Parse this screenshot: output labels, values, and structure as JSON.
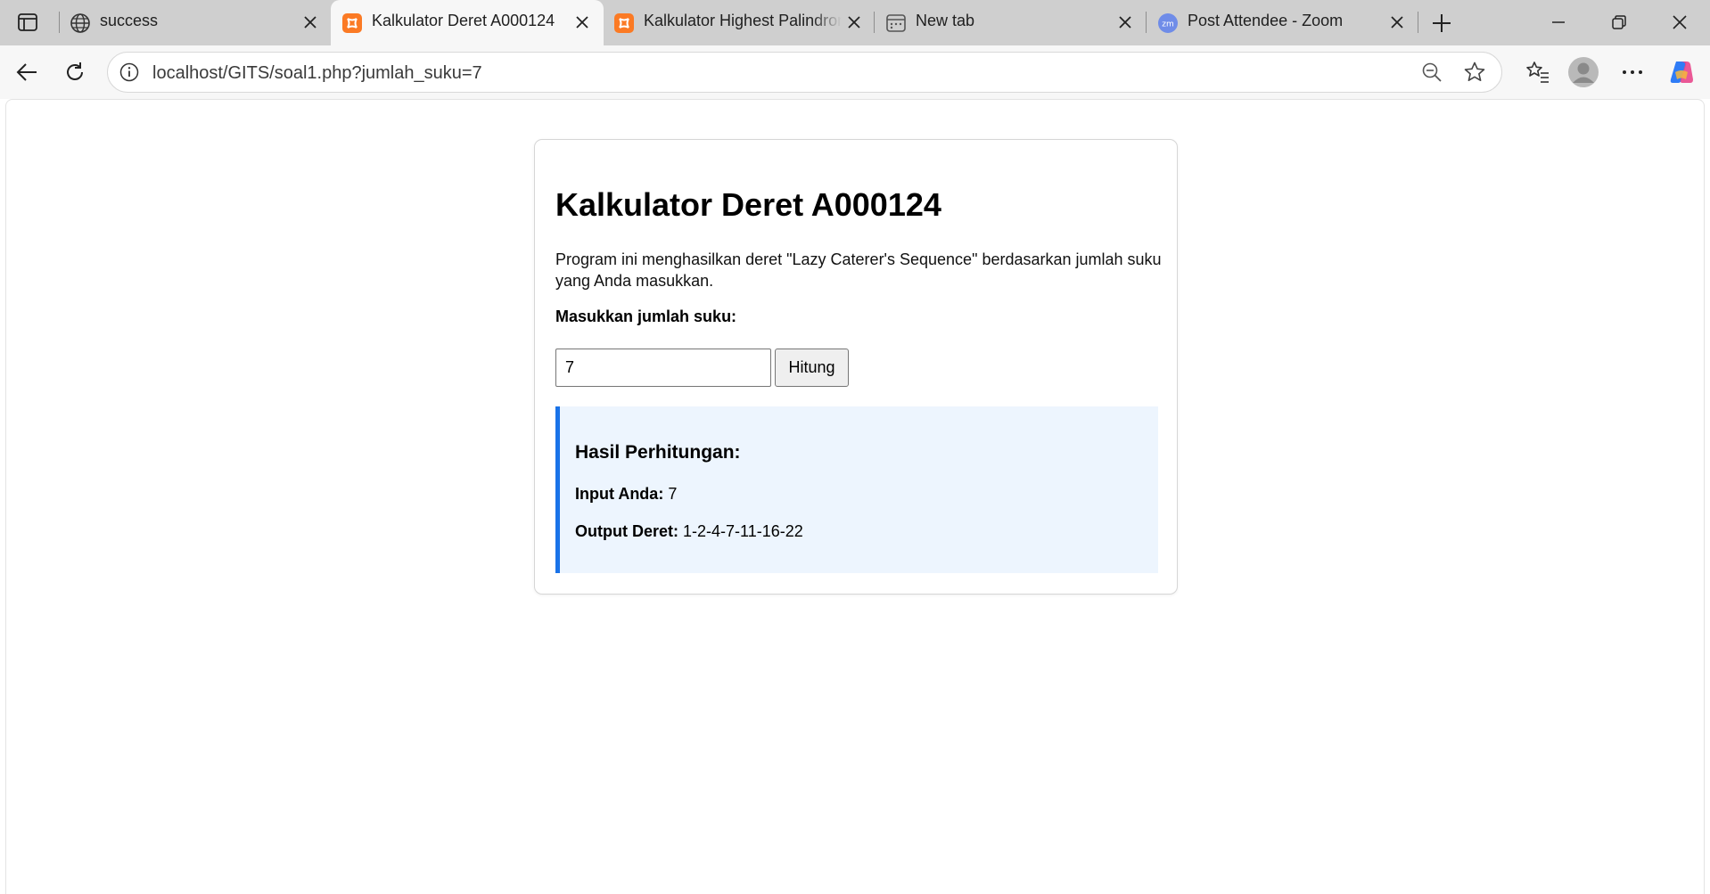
{
  "browser": {
    "tabs": [
      {
        "title": "success",
        "favicon": "globe-icon",
        "active": false
      },
      {
        "title": "Kalkulator Deret A000124",
        "favicon": "xampp-icon",
        "active": true
      },
      {
        "title": "Kalkulator Highest Palindrome",
        "favicon": "xampp-icon",
        "active": false
      },
      {
        "title": "New tab",
        "favicon": "newtab-page-icon",
        "active": false
      },
      {
        "title": "Post Attendee - Zoom",
        "favicon": "zoom-icon",
        "active": false
      }
    ],
    "url": "localhost/GITS/soal1.php?jumlah_suku=7"
  },
  "page": {
    "title": "Kalkulator Deret A000124",
    "description": "Program ini menghasilkan deret \"Lazy Caterer's Sequence\" berdasarkan jumlah suku yang Anda masukkan.",
    "input_label": "Masukkan jumlah suku:",
    "input_value": "7",
    "submit_label": "Hitung",
    "result": {
      "heading": "Hasil Perhitungan:",
      "input_label": "Input Anda:",
      "input_value": "7",
      "output_label": "Output Deret:",
      "output_value": "1-2-4-7-11-16-22"
    }
  },
  "colors": {
    "accent": "#1a73e8",
    "result_bg": "#edf5fe",
    "xampp_orange": "#fb7a24",
    "zoom_blue": "#6f8ce8"
  }
}
